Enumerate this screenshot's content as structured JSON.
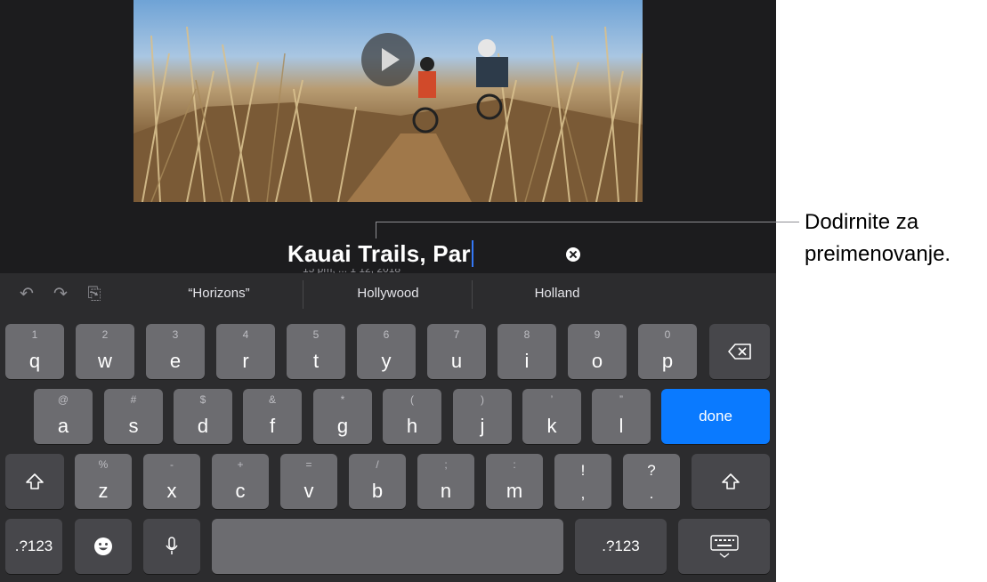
{
  "title_field": {
    "value": "Kauai Trails, Par",
    "subtitle": "15 pm, ... 1 12, 2018"
  },
  "callout": {
    "line1": "Dodirnite za",
    "line2": "preimenovanje."
  },
  "predictions": [
    "“Horizons”",
    "Hollywood",
    "Holland"
  ],
  "toolbar_icons": [
    "undo-icon",
    "redo-icon",
    "paste-icon"
  ],
  "keys": {
    "row1": [
      {
        "h": "1",
        "k": "q"
      },
      {
        "h": "2",
        "k": "w"
      },
      {
        "h": "3",
        "k": "e"
      },
      {
        "h": "4",
        "k": "r"
      },
      {
        "h": "5",
        "k": "t"
      },
      {
        "h": "6",
        "k": "y"
      },
      {
        "h": "7",
        "k": "u"
      },
      {
        "h": "8",
        "k": "i"
      },
      {
        "h": "9",
        "k": "o"
      },
      {
        "h": "0",
        "k": "p"
      }
    ],
    "row2": [
      {
        "h": "@",
        "k": "a"
      },
      {
        "h": "#",
        "k": "s"
      },
      {
        "h": "$",
        "k": "d"
      },
      {
        "h": "&",
        "k": "f"
      },
      {
        "h": "*",
        "k": "g"
      },
      {
        "h": "(",
        "k": "h"
      },
      {
        "h": ")",
        "k": "j"
      },
      {
        "h": "’",
        "k": "k"
      },
      {
        "h": "”",
        "k": "l"
      }
    ],
    "row3": [
      {
        "h": "%",
        "k": "z"
      },
      {
        "h": "-",
        "k": "x"
      },
      {
        "h": "+",
        "k": "c"
      },
      {
        "h": "=",
        "k": "v"
      },
      {
        "h": "/",
        "k": "b"
      },
      {
        "h": ";",
        "k": "n"
      },
      {
        "h": ":",
        "k": "m"
      },
      {
        "h": "!",
        "k": ","
      },
      {
        "h": "?",
        "k": "."
      }
    ],
    "done": "done",
    "numbers_left": ".?123",
    "numbers_right": ".?123"
  },
  "colors": {
    "accent": "#0a7aff",
    "key": "#6c6c70",
    "key_dark": "#47474b",
    "keyboard_bg": "#2c2c2e"
  }
}
